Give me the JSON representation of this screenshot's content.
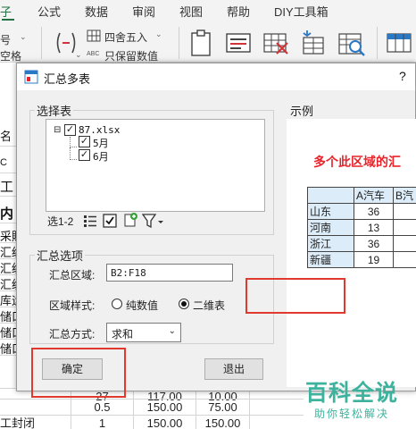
{
  "ribbon": {
    "menu": [
      "子",
      "公式",
      "数据",
      "审阅",
      "视图",
      "帮助",
      "DIY工具箱"
    ],
    "left_fragments": [
      "号",
      "空格"
    ],
    "round_button_label": "四舍五入",
    "keep_value_label": "只保留数值",
    "keep_value_prefix": "ABC"
  },
  "sheet": {
    "left_cells": [
      "名",
      "C",
      "工",
      "内",
      "采購",
      "汇级",
      "汇级",
      "汇级",
      "库运",
      "储口",
      "储口",
      "储口"
    ],
    "bottom_rows": [
      [
        "",
        "",
        "27",
        "117.00",
        "10.00"
      ],
      [
        "",
        "",
        "0.5",
        "150.00",
        "75.00"
      ],
      [
        "工封闭",
        "",
        "1",
        "150.00",
        "150.00"
      ]
    ]
  },
  "dialog": {
    "title": "汇总多表",
    "help": "?",
    "select_group_label": "选择表",
    "tree": {
      "root": "87.xlsx",
      "children": [
        "5月",
        "6月"
      ]
    },
    "toolbar_label": "选1-2",
    "options_group_label": "汇总选项",
    "range_label": "汇总区域:",
    "range_value": "B2:F18",
    "style_label": "区域样式:",
    "style_options": [
      "纯数值",
      "二维表"
    ],
    "style_selected": "二维表",
    "method_label": "汇总方式:",
    "method_value": "求和",
    "ok_button": "确定",
    "exit_button": "退出",
    "preview_label": "示例",
    "preview": {
      "headline": "多个此区域的汇",
      "header": [
        "",
        "A汽车",
        "B汽"
      ],
      "rows": [
        [
          "山东",
          "36"
        ],
        [
          "河南",
          "13"
        ],
        [
          "浙江",
          "36"
        ],
        [
          "新疆",
          "19"
        ]
      ]
    }
  },
  "watermark": {
    "main": "百科全说",
    "sub": "助你轻松解决"
  },
  "colors": {
    "accent": "#217346",
    "highlight": "#e03a2f",
    "watermark": "#3db39e"
  }
}
